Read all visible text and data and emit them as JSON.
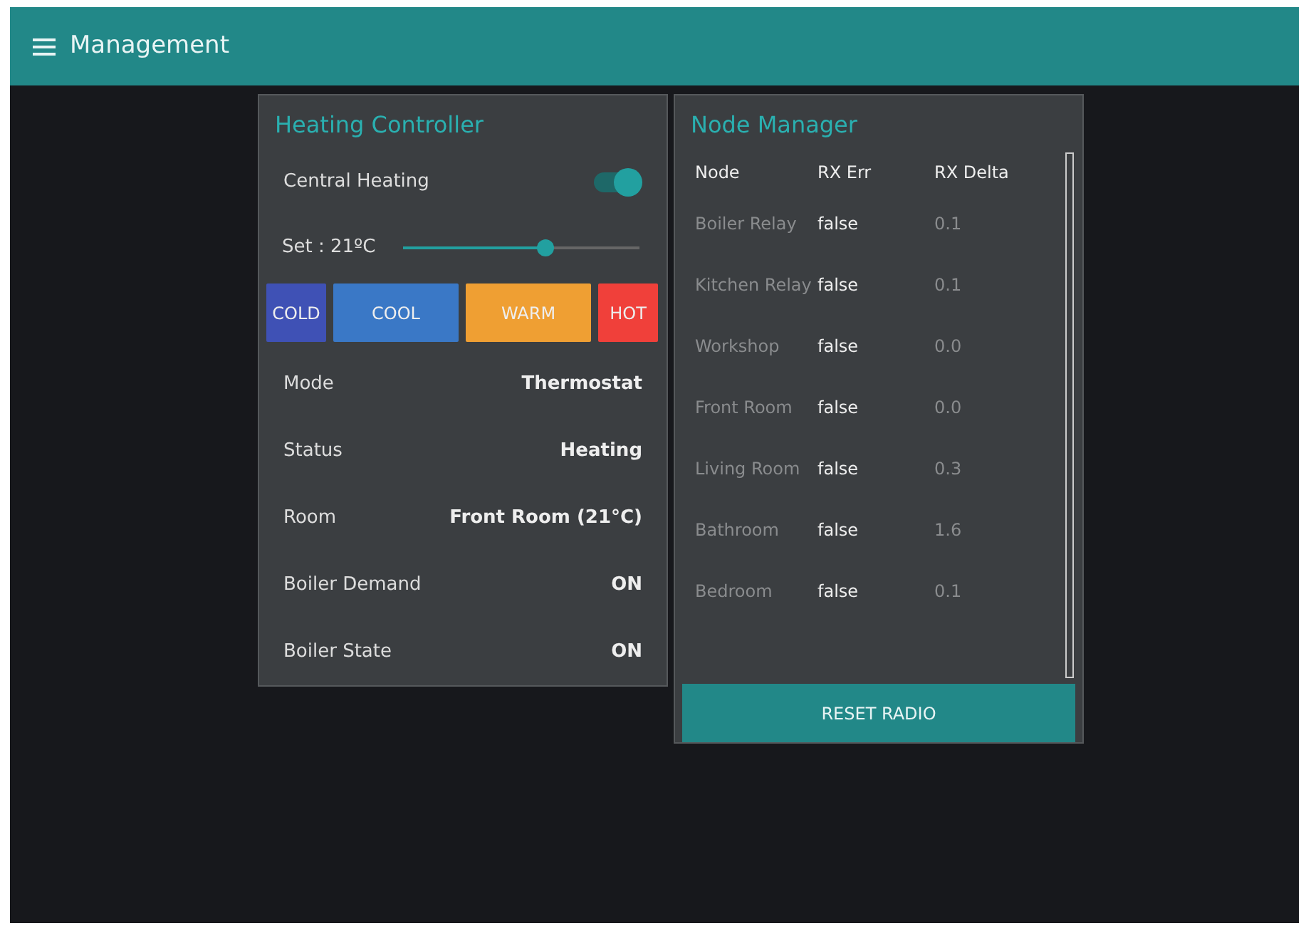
{
  "app_bar": {
    "title": "Management"
  },
  "heating": {
    "title": "Heating Controller",
    "central_heating": {
      "label": "Central Heating",
      "on": true
    },
    "setpoint": {
      "label": "Set : 21ºC",
      "level": 0.6
    },
    "presets": [
      {
        "label": "COLD",
        "color": "#3f51b5",
        "wide": false
      },
      {
        "label": "COOL",
        "color": "#3a78c6",
        "wide": true
      },
      {
        "label": "WARM",
        "color": "#ef9f33",
        "wide": true
      },
      {
        "label": "HOT",
        "color": "#f0403a",
        "wide": false
      }
    ],
    "fields": [
      {
        "label": "Mode",
        "value": "Thermostat"
      },
      {
        "label": "Status",
        "value": "Heating"
      },
      {
        "label": "Room",
        "value": "Front Room (21°C)"
      },
      {
        "label": "Boiler Demand",
        "value": "ON"
      },
      {
        "label": "Boiler State",
        "value": "ON"
      }
    ]
  },
  "nodes": {
    "title": "Node Manager",
    "columns": [
      "Node",
      "RX Err",
      "RX Delta"
    ],
    "rows": [
      [
        "Boiler Relay",
        "false",
        "0.1"
      ],
      [
        "Kitchen Relay",
        "false",
        "0.1"
      ],
      [
        "Workshop",
        "false",
        "0.0"
      ],
      [
        "Front Room",
        "false",
        "0.0"
      ],
      [
        "Living Room",
        "false",
        "0.3"
      ],
      [
        "Bathroom",
        "false",
        "1.6"
      ],
      [
        "Bedroom",
        "false",
        "0.1"
      ]
    ],
    "button": "RESET RADIO"
  }
}
